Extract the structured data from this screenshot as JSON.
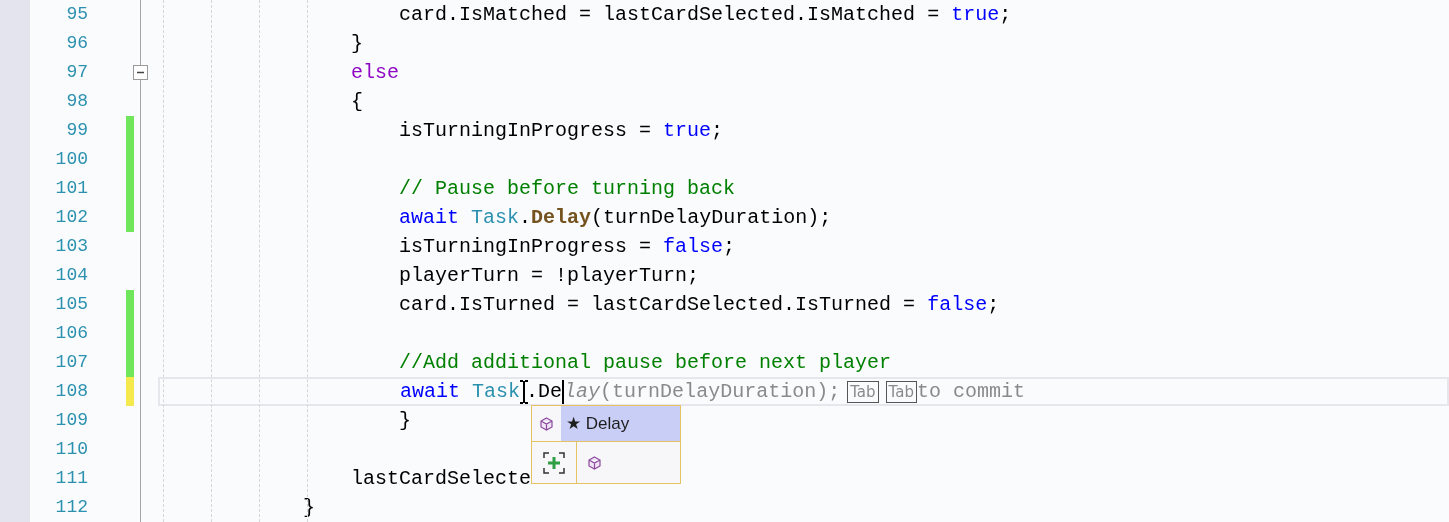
{
  "editor": {
    "lines": [
      {
        "number": "95",
        "tokens": [
          {
            "kind": "plain",
            "text": "                    card.IsMatched = lastCardSelected.IsMatched = "
          },
          {
            "kind": "keyword",
            "text": "true"
          },
          {
            "kind": "plain",
            "text": ";"
          }
        ]
      },
      {
        "number": "96",
        "tokens": [
          {
            "kind": "plain",
            "text": "                }"
          }
        ]
      },
      {
        "number": "97",
        "fold_expanded": true,
        "tokens": [
          {
            "kind": "control",
            "text": "                else"
          }
        ]
      },
      {
        "number": "98",
        "tokens": [
          {
            "kind": "plain",
            "text": "                {"
          }
        ]
      },
      {
        "number": "99",
        "color": "#6fe65b",
        "tokens": [
          {
            "kind": "plain",
            "text": "                    isTurningInProgress = "
          },
          {
            "kind": "keyword",
            "text": "true"
          },
          {
            "kind": "plain",
            "text": ";"
          }
        ]
      },
      {
        "number": "100",
        "color": "#6fe65b"
      },
      {
        "number": "101",
        "color": "#6fe65b",
        "tokens": [
          {
            "kind": "comment",
            "text": "                    // Pause before turning back"
          }
        ]
      },
      {
        "number": "102",
        "color": "#6fe65b",
        "tokens": [
          {
            "kind": "keyword",
            "text": "                    await"
          },
          {
            "kind": "type",
            "text": " Task"
          },
          {
            "kind": "plain",
            "text": "."
          },
          {
            "kind": "method",
            "text": "Delay"
          },
          {
            "kind": "plain",
            "text": "(turnDelayDuration);"
          }
        ]
      },
      {
        "number": "103",
        "tokens": [
          {
            "kind": "plain",
            "text": "                    isTurningInProgress = "
          },
          {
            "kind": "keyword",
            "text": "false"
          },
          {
            "kind": "plain",
            "text": ";"
          }
        ]
      },
      {
        "number": "104",
        "tokens": [
          {
            "kind": "plain",
            "text": "                    playerTurn = !playerTurn;"
          }
        ]
      },
      {
        "number": "105",
        "color": "#6fe65b",
        "tokens": [
          {
            "kind": "plain",
            "text": "                    card.IsTurned = lastCardSelected.IsTurned = "
          },
          {
            "kind": "keyword",
            "text": "false"
          },
          {
            "kind": "plain",
            "text": ";"
          }
        ]
      },
      {
        "number": "106",
        "color": "#6fe65b"
      },
      {
        "number": "107",
        "color": "#6fe65b",
        "tokens": [
          {
            "kind": "comment",
            "text": "                    //Add additional pause before next player"
          }
        ]
      },
      {
        "number": "108",
        "color": "#f5e94e",
        "current": true,
        "tokens": [
          {
            "kind": "keyword",
            "text": "                    await"
          },
          {
            "kind": "type",
            "text": " Task"
          },
          {
            "kind": "pointer"
          },
          {
            "kind": "plain",
            "text": ".De"
          },
          {
            "kind": "caret"
          },
          {
            "kind": "ghost_italic",
            "text": "lay"
          },
          {
            "kind": "ghost",
            "text": "(turnDelayDuration);"
          },
          {
            "kind": "key",
            "text": "Tab"
          },
          {
            "kind": "key",
            "text": "Tab"
          },
          {
            "kind": "hint",
            "text": "to commit"
          }
        ]
      },
      {
        "number": "109",
        "tokens": [
          {
            "kind": "plain",
            "text": "                    }"
          }
        ]
      },
      {
        "number": "110"
      },
      {
        "number": "111",
        "tokens": [
          {
            "kind": "plain",
            "text": "                lastCardSelecte"
          }
        ]
      },
      {
        "number": "112",
        "tokens": [
          {
            "kind": "plain",
            "text": "            }"
          }
        ]
      }
    ]
  },
  "completion": {
    "items": [
      {
        "label": "★ Delay",
        "selected": true
      }
    ]
  }
}
